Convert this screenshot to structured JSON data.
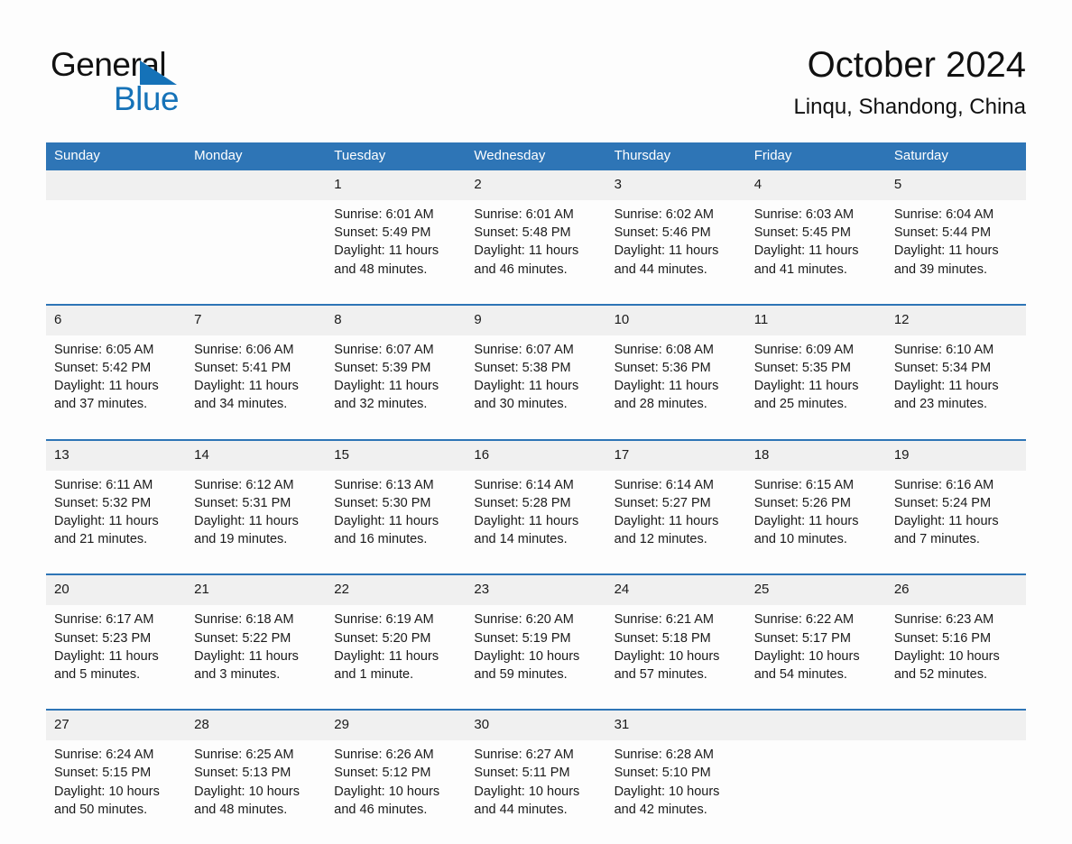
{
  "brand": {
    "name_part1": "General",
    "name_part2": "Blue"
  },
  "header": {
    "title": "October 2024",
    "location": "Linqu, Shandong, China"
  },
  "colors": {
    "header_blue": "#2E75B6",
    "daynum_band": "#F0F0F0",
    "logo_blue": "#1572B8",
    "page_background": "#FDFDFD"
  },
  "weekday_headers": [
    "Sunday",
    "Monday",
    "Tuesday",
    "Wednesday",
    "Thursday",
    "Friday",
    "Saturday"
  ],
  "labels": {
    "sunrise_prefix": "Sunrise:",
    "sunset_prefix": "Sunset:",
    "daylight_prefix": "Daylight:"
  },
  "weeks": [
    [
      {
        "day": "",
        "blank": true,
        "sunrise": "",
        "sunset": "",
        "daylight_line1": "",
        "daylight_line2": ""
      },
      {
        "day": "",
        "blank": true,
        "sunrise": "",
        "sunset": "",
        "daylight_line1": "",
        "daylight_line2": ""
      },
      {
        "day": "1",
        "blank": false,
        "sunrise": "Sunrise: 6:01 AM",
        "sunset": "Sunset: 5:49 PM",
        "daylight_line1": "Daylight: 11 hours",
        "daylight_line2": "and 48 minutes."
      },
      {
        "day": "2",
        "blank": false,
        "sunrise": "Sunrise: 6:01 AM",
        "sunset": "Sunset: 5:48 PM",
        "daylight_line1": "Daylight: 11 hours",
        "daylight_line2": "and 46 minutes."
      },
      {
        "day": "3",
        "blank": false,
        "sunrise": "Sunrise: 6:02 AM",
        "sunset": "Sunset: 5:46 PM",
        "daylight_line1": "Daylight: 11 hours",
        "daylight_line2": "and 44 minutes."
      },
      {
        "day": "4",
        "blank": false,
        "sunrise": "Sunrise: 6:03 AM",
        "sunset": "Sunset: 5:45 PM",
        "daylight_line1": "Daylight: 11 hours",
        "daylight_line2": "and 41 minutes."
      },
      {
        "day": "5",
        "blank": false,
        "sunrise": "Sunrise: 6:04 AM",
        "sunset": "Sunset: 5:44 PM",
        "daylight_line1": "Daylight: 11 hours",
        "daylight_line2": "and 39 minutes."
      }
    ],
    [
      {
        "day": "6",
        "blank": false,
        "sunrise": "Sunrise: 6:05 AM",
        "sunset": "Sunset: 5:42 PM",
        "daylight_line1": "Daylight: 11 hours",
        "daylight_line2": "and 37 minutes."
      },
      {
        "day": "7",
        "blank": false,
        "sunrise": "Sunrise: 6:06 AM",
        "sunset": "Sunset: 5:41 PM",
        "daylight_line1": "Daylight: 11 hours",
        "daylight_line2": "and 34 minutes."
      },
      {
        "day": "8",
        "blank": false,
        "sunrise": "Sunrise: 6:07 AM",
        "sunset": "Sunset: 5:39 PM",
        "daylight_line1": "Daylight: 11 hours",
        "daylight_line2": "and 32 minutes."
      },
      {
        "day": "9",
        "blank": false,
        "sunrise": "Sunrise: 6:07 AM",
        "sunset": "Sunset: 5:38 PM",
        "daylight_line1": "Daylight: 11 hours",
        "daylight_line2": "and 30 minutes."
      },
      {
        "day": "10",
        "blank": false,
        "sunrise": "Sunrise: 6:08 AM",
        "sunset": "Sunset: 5:36 PM",
        "daylight_line1": "Daylight: 11 hours",
        "daylight_line2": "and 28 minutes."
      },
      {
        "day": "11",
        "blank": false,
        "sunrise": "Sunrise: 6:09 AM",
        "sunset": "Sunset: 5:35 PM",
        "daylight_line1": "Daylight: 11 hours",
        "daylight_line2": "and 25 minutes."
      },
      {
        "day": "12",
        "blank": false,
        "sunrise": "Sunrise: 6:10 AM",
        "sunset": "Sunset: 5:34 PM",
        "daylight_line1": "Daylight: 11 hours",
        "daylight_line2": "and 23 minutes."
      }
    ],
    [
      {
        "day": "13",
        "blank": false,
        "sunrise": "Sunrise: 6:11 AM",
        "sunset": "Sunset: 5:32 PM",
        "daylight_line1": "Daylight: 11 hours",
        "daylight_line2": "and 21 minutes."
      },
      {
        "day": "14",
        "blank": false,
        "sunrise": "Sunrise: 6:12 AM",
        "sunset": "Sunset: 5:31 PM",
        "daylight_line1": "Daylight: 11 hours",
        "daylight_line2": "and 19 minutes."
      },
      {
        "day": "15",
        "blank": false,
        "sunrise": "Sunrise: 6:13 AM",
        "sunset": "Sunset: 5:30 PM",
        "daylight_line1": "Daylight: 11 hours",
        "daylight_line2": "and 16 minutes."
      },
      {
        "day": "16",
        "blank": false,
        "sunrise": "Sunrise: 6:14 AM",
        "sunset": "Sunset: 5:28 PM",
        "daylight_line1": "Daylight: 11 hours",
        "daylight_line2": "and 14 minutes."
      },
      {
        "day": "17",
        "blank": false,
        "sunrise": "Sunrise: 6:14 AM",
        "sunset": "Sunset: 5:27 PM",
        "daylight_line1": "Daylight: 11 hours",
        "daylight_line2": "and 12 minutes."
      },
      {
        "day": "18",
        "blank": false,
        "sunrise": "Sunrise: 6:15 AM",
        "sunset": "Sunset: 5:26 PM",
        "daylight_line1": "Daylight: 11 hours",
        "daylight_line2": "and 10 minutes."
      },
      {
        "day": "19",
        "blank": false,
        "sunrise": "Sunrise: 6:16 AM",
        "sunset": "Sunset: 5:24 PM",
        "daylight_line1": "Daylight: 11 hours",
        "daylight_line2": "and 7 minutes."
      }
    ],
    [
      {
        "day": "20",
        "blank": false,
        "sunrise": "Sunrise: 6:17 AM",
        "sunset": "Sunset: 5:23 PM",
        "daylight_line1": "Daylight: 11 hours",
        "daylight_line2": "and 5 minutes."
      },
      {
        "day": "21",
        "blank": false,
        "sunrise": "Sunrise: 6:18 AM",
        "sunset": "Sunset: 5:22 PM",
        "daylight_line1": "Daylight: 11 hours",
        "daylight_line2": "and 3 minutes."
      },
      {
        "day": "22",
        "blank": false,
        "sunrise": "Sunrise: 6:19 AM",
        "sunset": "Sunset: 5:20 PM",
        "daylight_line1": "Daylight: 11 hours",
        "daylight_line2": "and 1 minute."
      },
      {
        "day": "23",
        "blank": false,
        "sunrise": "Sunrise: 6:20 AM",
        "sunset": "Sunset: 5:19 PM",
        "daylight_line1": "Daylight: 10 hours",
        "daylight_line2": "and 59 minutes."
      },
      {
        "day": "24",
        "blank": false,
        "sunrise": "Sunrise: 6:21 AM",
        "sunset": "Sunset: 5:18 PM",
        "daylight_line1": "Daylight: 10 hours",
        "daylight_line2": "and 57 minutes."
      },
      {
        "day": "25",
        "blank": false,
        "sunrise": "Sunrise: 6:22 AM",
        "sunset": "Sunset: 5:17 PM",
        "daylight_line1": "Daylight: 10 hours",
        "daylight_line2": "and 54 minutes."
      },
      {
        "day": "26",
        "blank": false,
        "sunrise": "Sunrise: 6:23 AM",
        "sunset": "Sunset: 5:16 PM",
        "daylight_line1": "Daylight: 10 hours",
        "daylight_line2": "and 52 minutes."
      }
    ],
    [
      {
        "day": "27",
        "blank": false,
        "sunrise": "Sunrise: 6:24 AM",
        "sunset": "Sunset: 5:15 PM",
        "daylight_line1": "Daylight: 10 hours",
        "daylight_line2": "and 50 minutes."
      },
      {
        "day": "28",
        "blank": false,
        "sunrise": "Sunrise: 6:25 AM",
        "sunset": "Sunset: 5:13 PM",
        "daylight_line1": "Daylight: 10 hours",
        "daylight_line2": "and 48 minutes."
      },
      {
        "day": "29",
        "blank": false,
        "sunrise": "Sunrise: 6:26 AM",
        "sunset": "Sunset: 5:12 PM",
        "daylight_line1": "Daylight: 10 hours",
        "daylight_line2": "and 46 minutes."
      },
      {
        "day": "30",
        "blank": false,
        "sunrise": "Sunrise: 6:27 AM",
        "sunset": "Sunset: 5:11 PM",
        "daylight_line1": "Daylight: 10 hours",
        "daylight_line2": "and 44 minutes."
      },
      {
        "day": "31",
        "blank": false,
        "sunrise": "Sunrise: 6:28 AM",
        "sunset": "Sunset: 5:10 PM",
        "daylight_line1": "Daylight: 10 hours",
        "daylight_line2": "and 42 minutes."
      },
      {
        "day": "",
        "blank": true,
        "sunrise": "",
        "sunset": "",
        "daylight_line1": "",
        "daylight_line2": ""
      },
      {
        "day": "",
        "blank": true,
        "sunrise": "",
        "sunset": "",
        "daylight_line1": "",
        "daylight_line2": ""
      }
    ]
  ]
}
